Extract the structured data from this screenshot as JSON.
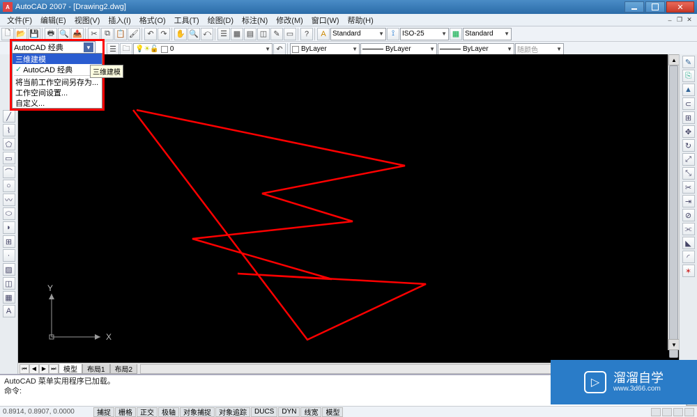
{
  "title": "AutoCAD 2007 - [Drawing2.dwg]",
  "menu": [
    "文件(F)",
    "编辑(E)",
    "视图(V)",
    "插入(I)",
    "格式(O)",
    "工具(T)",
    "绘图(D)",
    "标注(N)",
    "修改(M)",
    "窗口(W)",
    "帮助(H)"
  ],
  "toolbar1": {
    "style_combo_label": "Standard",
    "dimstyle_combo_label": "ISO-25",
    "tablestyle_combo_label": "Standard"
  },
  "toolbar2": {
    "layer_display": "0",
    "color_combo": "ByLayer",
    "linetype_combo": "ByLayer",
    "lineweight_combo": "ByLayer",
    "plot_combo": "随颜色"
  },
  "dropdown": {
    "current": "AutoCAD 经典",
    "items": [
      "三维建模",
      "AutoCAD 经典",
      "将当前工作空间另存为...",
      "工作空间设置...",
      "自定义..."
    ],
    "selected_index": 0,
    "tooltip": "三维建模"
  },
  "ucs": {
    "x": "X",
    "y": "Y"
  },
  "model_tabs": [
    "模型",
    "布局1",
    "布局2"
  ],
  "cmd": {
    "line1": "AutoCAD 菜单实用程序已加载。",
    "line2": "命令:"
  },
  "status": {
    "coords": "0.8914, 0.8907, 0.0000",
    "toggles": [
      "捕捉",
      "栅格",
      "正交",
      "极轴",
      "对象捕捉",
      "对象追踪",
      "DUCS",
      "DYN",
      "线宽",
      "模型"
    ]
  },
  "watermark": {
    "name": "溜溜自学",
    "url": "www.3d66.com"
  }
}
